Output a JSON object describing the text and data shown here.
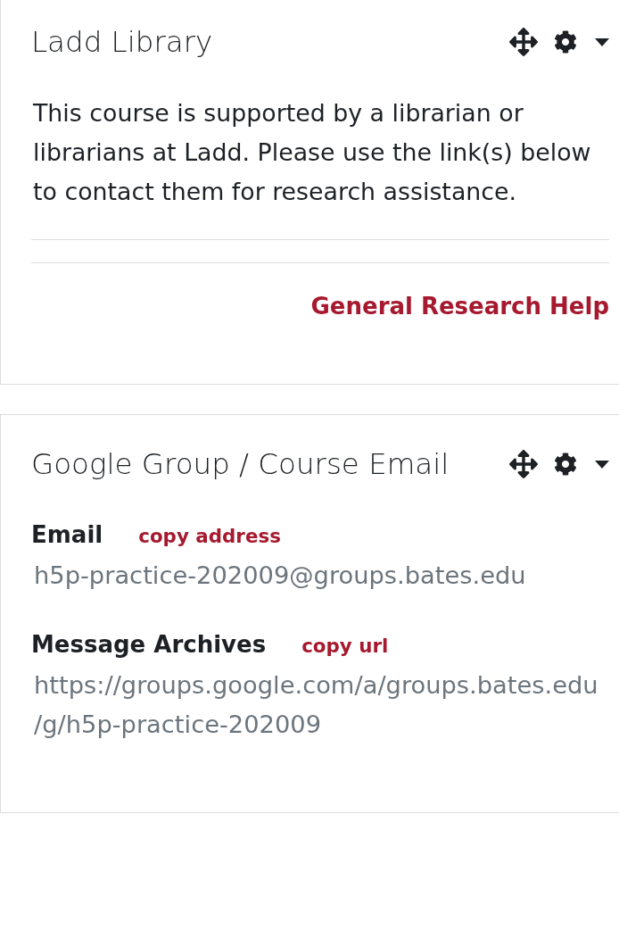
{
  "blocks": [
    {
      "kind": "library",
      "title": "Ladd Library",
      "description": "This course is supported by a librarian or librarians at Ladd. Please use the link(s) below to contact them for research assistance.",
      "links": [
        "General Research Help"
      ]
    },
    {
      "kind": "group_email",
      "title": "Google Group / Course Email",
      "fields": [
        {
          "label": "Email",
          "action": "copy address",
          "value": "h5p-practice-202009@groups.bates.edu"
        },
        {
          "label": "Message Archives",
          "action": "copy url",
          "value": "https://groups.google.com/a/groups.bates.edu/g/h5p-practice-202009"
        }
      ]
    }
  ]
}
